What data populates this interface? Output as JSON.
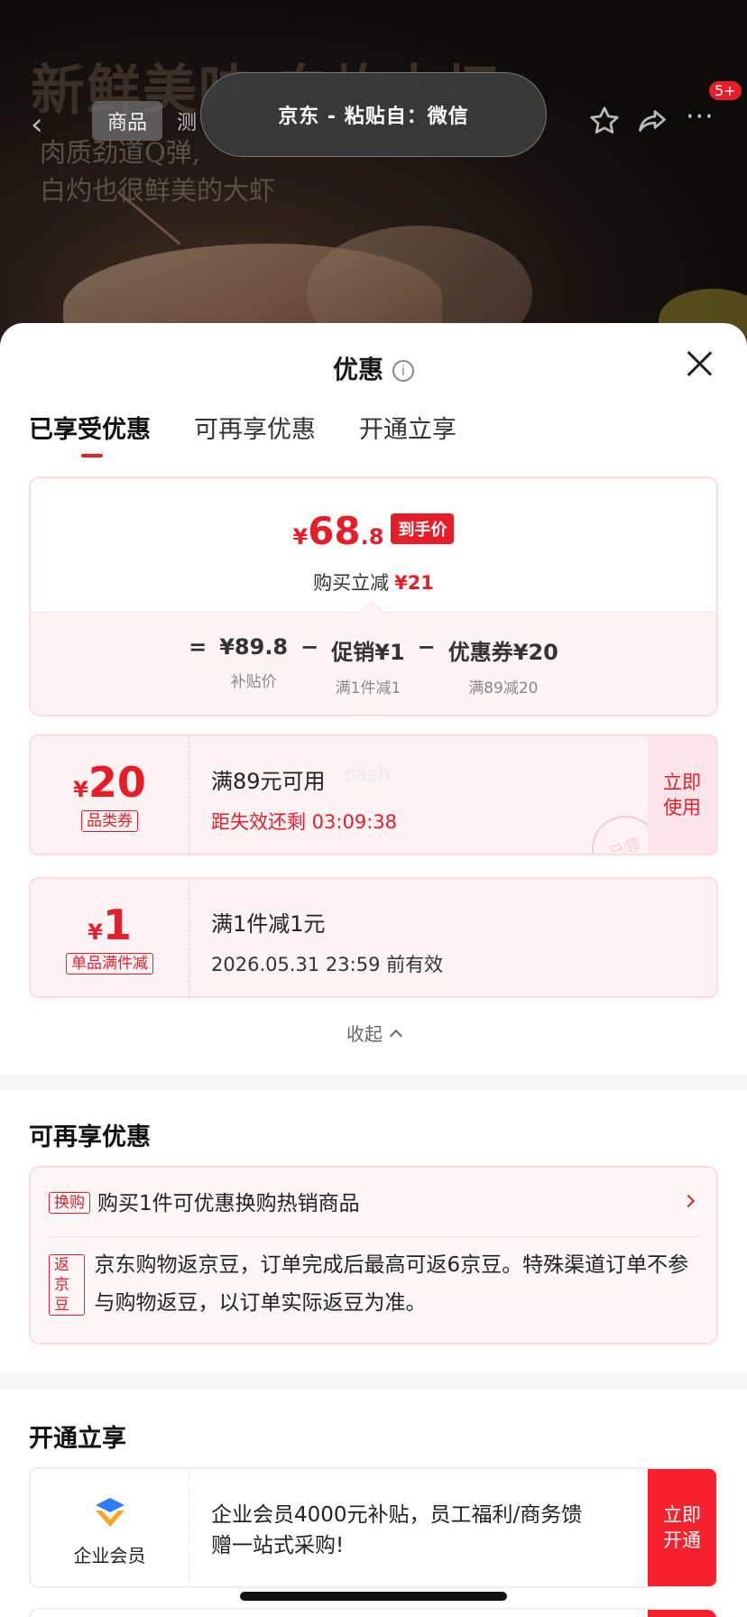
{
  "hero": {
    "title": "新鲜美味 白灼大虾",
    "subtitle_line1": "肉质劲道Q弹,",
    "subtitle_line2": "白灼也很鲜美的大虾"
  },
  "topbar": {
    "tab_goods": "商品",
    "tab_partial": "测",
    "clipboard_banner": "京东 - 粘贴自：微信",
    "more_badge": "5+"
  },
  "sheet": {
    "title": "优惠",
    "info_glyph": "i",
    "tabs": [
      "已享受优惠",
      "可再享优惠",
      "开通立享"
    ]
  },
  "summary": {
    "yen": "¥",
    "price_int": "68",
    "price_dec": ".8",
    "price_tag": "到手价",
    "instant_label": "购买立减",
    "instant_value": "¥21",
    "formula": [
      {
        "value": "¥89.8",
        "label": "补贴价"
      },
      {
        "value": "促销¥1",
        "label": "满1件减1"
      },
      {
        "value": "优惠券¥20",
        "label": "满89减20"
      }
    ],
    "eq": "=",
    "minus": "−"
  },
  "coupons": [
    {
      "yen": "¥",
      "amount": "20",
      "kind": "品类券",
      "line1": "满89元可用",
      "line2": "距失效还剩 03:09:38",
      "action": "立即使用",
      "stamp": "已领",
      "watermark": "cash"
    },
    {
      "yen": "¥",
      "amount": "1",
      "kind": "单品满件减",
      "line1": "满1件减1元",
      "line2": "2026.05.31 23:59 前有效"
    }
  ],
  "collapse_label": "收起",
  "more": {
    "title": "可再享优惠",
    "items": [
      {
        "tag": "换购",
        "text": "购买1件可优惠换购热销商品"
      },
      {
        "tag": "返京豆",
        "text": "京东购物返京豆，订单完成后最高可返6京豆。特殊渠道订单不参与购物返豆，以订单实际返豆为准。"
      }
    ]
  },
  "open": {
    "title": "开通立享",
    "vip_name": "企业会员",
    "vip_desc": "企业会员4000元补贴，员工福利/商务馈赠一站式采购!",
    "vip_action": "立即开通"
  },
  "colors": {
    "accent": "#e51e2a",
    "card_bg": "#fdf3f4",
    "card_border": "#fbdcdf"
  }
}
